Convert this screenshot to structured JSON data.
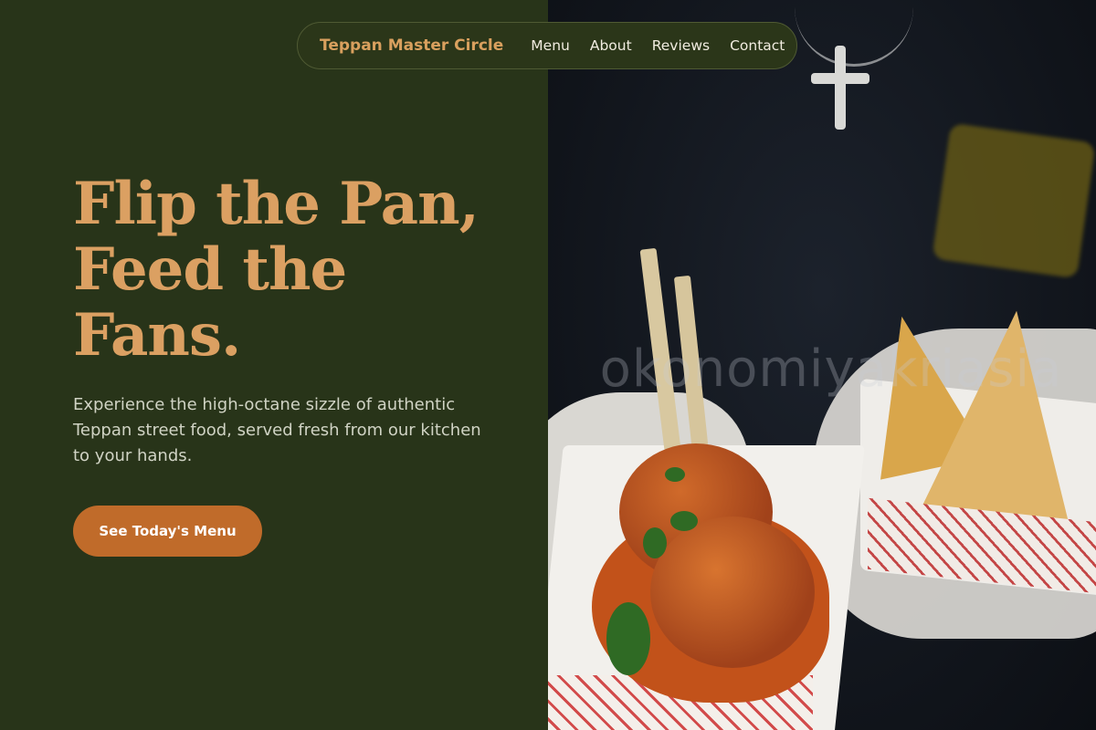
{
  "nav": {
    "brand": "Teppan Master Circle",
    "links": [
      "Menu",
      "About",
      "Reviews",
      "Contact"
    ]
  },
  "hero": {
    "title_lines": [
      "Flip the Pan,",
      "Feed the",
      "Fans."
    ],
    "subtitle": "Experience the high-octane sizzle of authentic Teppan street food, served fresh from our kitchen to your hands.",
    "cta_label": "See Today's Menu"
  },
  "photo": {
    "watermark": "okonomiyakriasia"
  },
  "colors": {
    "background": "#283419",
    "accent": "#dba062",
    "cta": "#c06b2a",
    "text_light": "#f1ece0"
  }
}
